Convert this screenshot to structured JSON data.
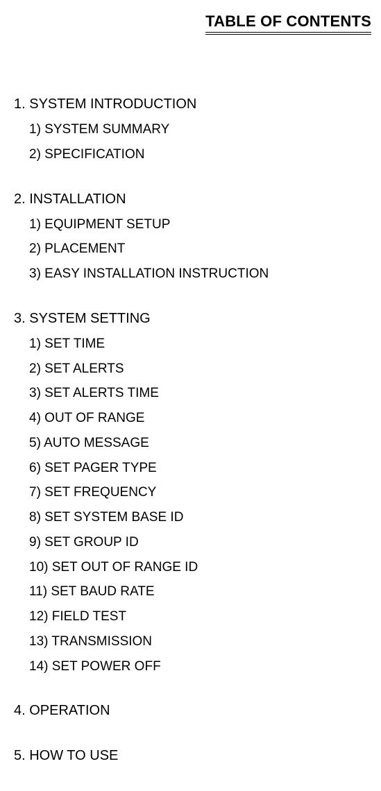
{
  "title": "TABLE OF CONTENTS",
  "sections": [
    {
      "label": "1. SYSTEM INTRODUCTION",
      "items": [
        "1) SYSTEM SUMMARY",
        "2) SPECIFICATION"
      ]
    },
    {
      "label": "2. INSTALLATION",
      "items": [
        "1) EQUIPMENT SETUP",
        "2) PLACEMENT",
        "3) EASY INSTALLATION INSTRUCTION"
      ]
    },
    {
      "label": "3. SYSTEM SETTING",
      "items": [
        "1) SET TIME",
        "2) SET ALERTS",
        "3) SET ALERTS TIME",
        "4) OUT OF RANGE",
        "5) AUTO MESSAGE",
        "6) SET PAGER TYPE",
        "7) SET FREQUENCY",
        "8) SET SYSTEM BASE ID",
        "9) SET GROUP ID",
        "10) SET OUT OF RANGE ID",
        "11) SET BAUD RATE",
        "12) FIELD TEST",
        "13) TRANSMISSION",
        "14) SET POWER OFF"
      ]
    },
    {
      "label": "4. OPERATION",
      "items": []
    },
    {
      "label": "5. HOW TO USE",
      "items": []
    }
  ]
}
